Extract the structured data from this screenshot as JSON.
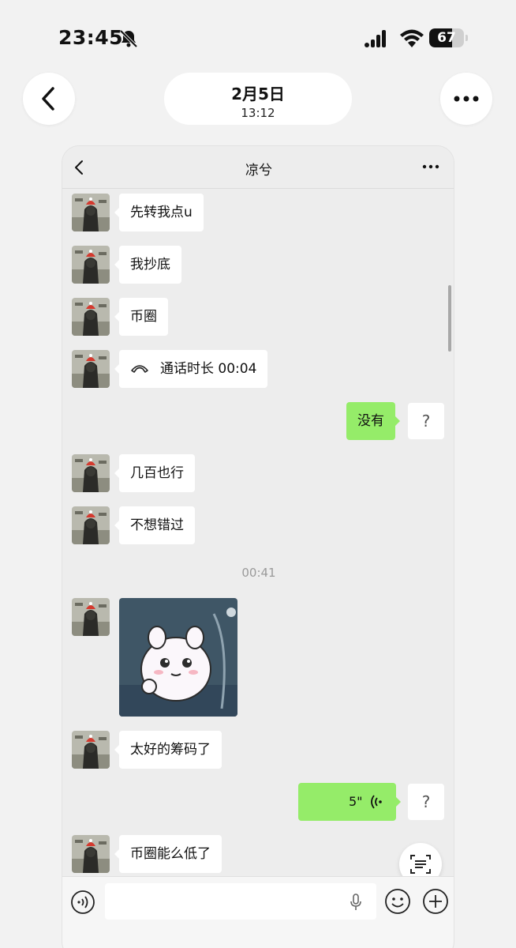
{
  "status_bar": {
    "time": "23:45",
    "battery_level": "67",
    "battery_fraction": 0.67
  },
  "top_bar": {
    "date": "2月5日",
    "time": "13:12"
  },
  "chat": {
    "contact_name": "凉兮",
    "messages": [
      {
        "side": "in",
        "type": "text",
        "text": "先转我点u"
      },
      {
        "side": "in",
        "type": "text",
        "text": "我抄底"
      },
      {
        "side": "in",
        "type": "text",
        "text": "币圈"
      },
      {
        "side": "in",
        "type": "call",
        "text": "通话时长 00:04"
      },
      {
        "side": "out",
        "type": "text",
        "text": "没有",
        "status": "?"
      },
      {
        "side": "in",
        "type": "text",
        "text": "几百也行"
      },
      {
        "side": "in",
        "type": "text",
        "text": "不想错过"
      },
      {
        "type": "timestamp",
        "text": "00:41"
      },
      {
        "side": "in",
        "type": "sticker",
        "text": ""
      },
      {
        "side": "in",
        "type": "text",
        "text": "太好的筹码了"
      },
      {
        "side": "out",
        "type": "voice",
        "text": "5\"",
        "status": "?"
      },
      {
        "side": "in",
        "type": "text",
        "text": "币圈能么低了"
      }
    ]
  },
  "input": {
    "placeholder": ""
  },
  "colors": {
    "outgoing_bubble": "#95ec69",
    "incoming_bubble": "#ffffff",
    "chat_background": "#ededed"
  },
  "icons": [
    "bell-slash-icon",
    "signal-icon",
    "wifi-icon",
    "battery-icon",
    "back-icon",
    "more-icon",
    "call-icon",
    "voice-wave-icon",
    "ocr-scan-icon",
    "voice-toggle-icon",
    "mic-icon",
    "emoji-icon",
    "plus-icon"
  ]
}
